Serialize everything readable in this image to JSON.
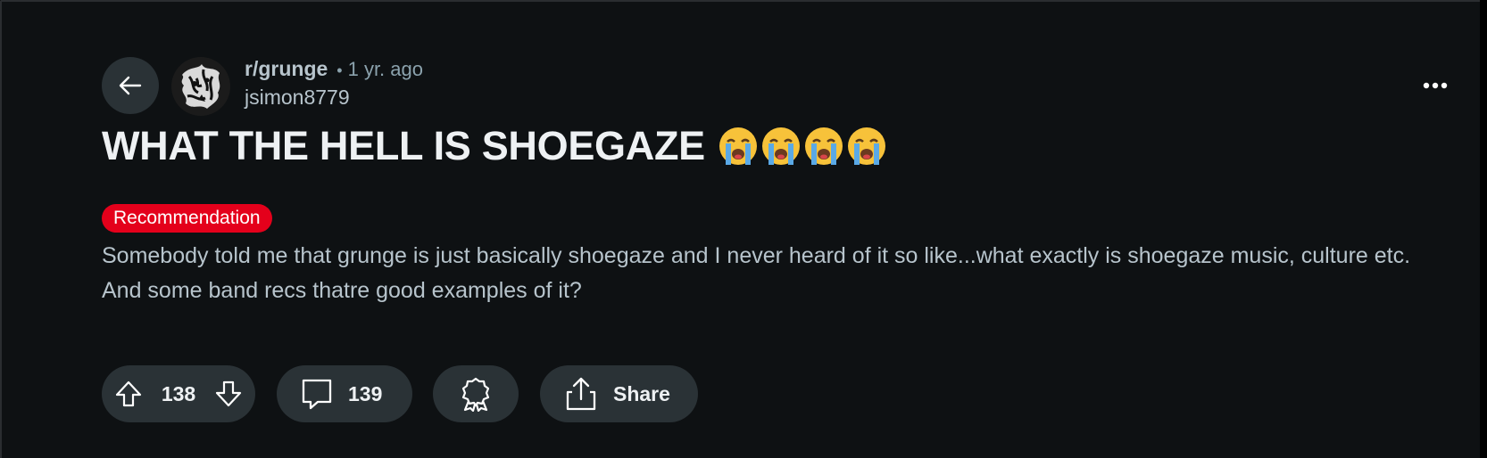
{
  "post": {
    "subreddit": "r/grunge",
    "separator": "•",
    "time_ago": "1 yr. ago",
    "author": "jsimon8779",
    "title": "WHAT THE HELL IS SHOEGAZE",
    "title_emoji": [
      "😭",
      "😭",
      "😭",
      "😭"
    ],
    "flair": "Recommendation",
    "body": "Somebody told me that grunge is just basically shoegaze and I never heard of it so like...what exactly is shoegaze music, culture etc. And some band recs thatre good examples of it?"
  },
  "actions": {
    "vote_count": "138",
    "comment_count": "139",
    "share_label": "Share"
  },
  "icons": {
    "back": "arrow-left-icon",
    "more": "more-horizontal-icon",
    "upvote": "arrow-up-icon",
    "downvote": "arrow-down-icon",
    "comment": "comment-bubble-icon",
    "award": "award-ribbon-icon",
    "share": "share-upload-icon"
  },
  "colors": {
    "background": "#0e1113",
    "pill": "#2a3236",
    "flair": "#e4001b",
    "text_primary": "#eef1f3",
    "text_secondary": "#b7c4cc"
  }
}
